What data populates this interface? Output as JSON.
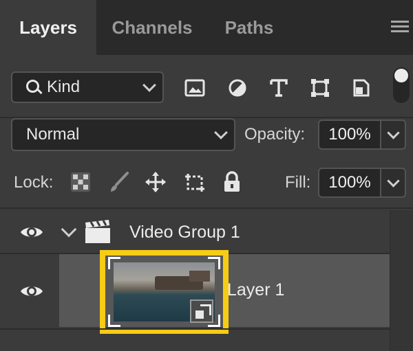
{
  "tabs": [
    {
      "label": "Layers",
      "active": true
    },
    {
      "label": "Channels",
      "active": false
    },
    {
      "label": "Paths",
      "active": false
    }
  ],
  "filter": {
    "kind_label": "Kind",
    "icons": [
      "image-filter-icon",
      "adjustment-filter-icon",
      "type-filter-icon",
      "shape-filter-icon",
      "smart-object-filter-icon"
    ]
  },
  "blend": {
    "mode": "Normal",
    "opacity_label": "Opacity:",
    "opacity_value": "100%"
  },
  "lock": {
    "label": "Lock:",
    "icons": [
      "lock-transparent-pixels-icon",
      "lock-image-pixels-icon",
      "lock-position-icon",
      "lock-artboard-icon",
      "lock-all-icon"
    ],
    "fill_label": "Fill:",
    "fill_value": "100%"
  },
  "layers": {
    "group_name": "Video Group 1",
    "layer_name": "Layer 1"
  },
  "colors": {
    "highlight": "#f6cc15",
    "panel_bg": "#3b3b3b",
    "selected_row": "#575757"
  }
}
